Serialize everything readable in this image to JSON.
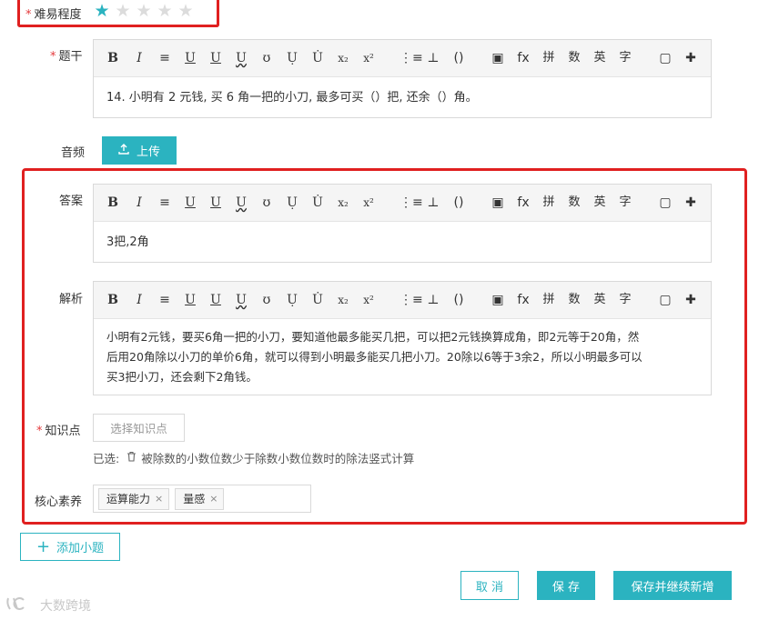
{
  "difficulty": {
    "label": "难易程度",
    "rating": 1,
    "max": 5
  },
  "stem": {
    "label": "题干",
    "content": "14. 小明有 2 元钱, 买 6 角一把的小刀, 最多可买（）把, 还余（）角。"
  },
  "toolbar": {
    "items": [
      "B",
      "I",
      "≡",
      "U",
      "U",
      "U",
      "ʊ",
      "Ụ",
      "U̇",
      "x₂",
      "x²",
      "⋮≡",
      "⊥",
      "()",
      "▣",
      "fx",
      "拼",
      "数",
      "英",
      "字",
      "▢",
      "✚"
    ],
    "icons": [
      "bold-icon",
      "italic-icon",
      "align-icon",
      "underline-icon",
      "double-underline-icon",
      "wavy-underline-icon",
      "strikethrough-icon",
      "dot-below-icon",
      "dot-above-icon",
      "subscript-icon",
      "superscript-icon",
      "list-icon",
      "blank-icon",
      "parentheses-icon",
      "image-icon",
      "formula-icon",
      "pinyin-icon",
      "number-icon",
      "english-icon",
      "chinese-char-icon",
      "ocr-icon",
      "eraser-icon"
    ]
  },
  "audio": {
    "label": "音频",
    "upload_label": "上传",
    "upload_icon": "upload-icon"
  },
  "answer": {
    "label": "答案",
    "content": "3把,2角"
  },
  "analysis": {
    "label": "解析",
    "lines": [
      "小明有2元钱，要买6角一把的小刀，要知道他最多能买几把，可以把2元钱换算成角，即2元等于20角，然",
      "后用20角除以小刀的单价6角，就可以得到小明最多能买几把小刀。20除以6等于3余2，所以小明最多可以",
      "买3把小刀，还会剩下2角钱。"
    ]
  },
  "knowledge": {
    "label": "知识点",
    "select_placeholder": "选择知识点",
    "selected_prefix": "已选:",
    "selected_item": "被除数的小数位数少于除数小数位数时的除法竖式计算"
  },
  "core_literacy": {
    "label": "核心素养",
    "tags": [
      "运算能力",
      "量感"
    ]
  },
  "add_sub_question": "添加小题",
  "actions": {
    "cancel": "取 消",
    "save": "保 存",
    "save_continue": "保存并继续新增"
  },
  "watermark": "大数跨境",
  "colors": {
    "accent": "#2bb3c0",
    "highlight_border": "#e02020",
    "required": "#e4393c"
  }
}
